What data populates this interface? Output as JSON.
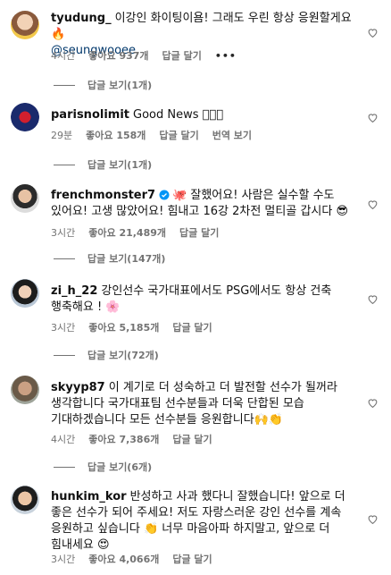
{
  "comments": [
    {
      "username": "tyudung_",
      "text": "이강인 화이팅이욤! 그래도 우린 항상 응원할게요🔥",
      "mention": "@seungwooee",
      "time": "4시간",
      "likes": "좋아요 937개",
      "reply": "답글 달기",
      "more": "•••",
      "view_replies": "답글 보기(1개)"
    },
    {
      "username": "parisnolimit",
      "text": "Good News 🏻🏻🏻",
      "time": "29분",
      "likes": "좋아요 158개",
      "reply": "답글 달기",
      "translate": "번역 보기",
      "view_replies": "답글 보기(1개)"
    },
    {
      "username": "frenchmonster7",
      "text": "🐙 잘했어요! 사람은 실수할 수도 있어요! 고생 많았어요! 힘내고 16강 2차전 멀티골 갑시다 😎",
      "time": "3시간",
      "likes": "좋아요 21,489개",
      "reply": "답글 달기",
      "view_replies": "답글 보기(147개)"
    },
    {
      "username": "zi_h_22",
      "text": "강인선수 국가대표에서도 PSG에서도 항상 건축 행축해요 ! 🌸",
      "time": "3시간",
      "likes": "좋아요 5,185개",
      "reply": "답글 달기",
      "view_replies": "답글 보기(72개)"
    },
    {
      "username": "skyyp87",
      "text": "이 계기로 더 성숙하고 더 발전할 선수가 될꺼라 생각합니다 국가대표팀 선수분들과 더욱 단합된 모습 기대하겠습니다 모든 선수분들 응원합니다🙌👏",
      "time": "4시간",
      "likes": "좋아요 7,386개",
      "reply": "답글 달기",
      "view_replies": "답글 보기(6개)"
    },
    {
      "username": "hunkim_kor",
      "text": "반성하고 사과 했다니 잘했습니다! 앞으로 더 좋은 선수가 되어 주세요! 저도 자랑스러운 강인 선수를 계속 응원하고 싶습니다 👏 너무 마음아파 하지말고, 앞으로 더 힘내세요 😍",
      "time": "3시간",
      "likes": "좋아요 4,066개",
      "reply": "답글 달기"
    }
  ]
}
